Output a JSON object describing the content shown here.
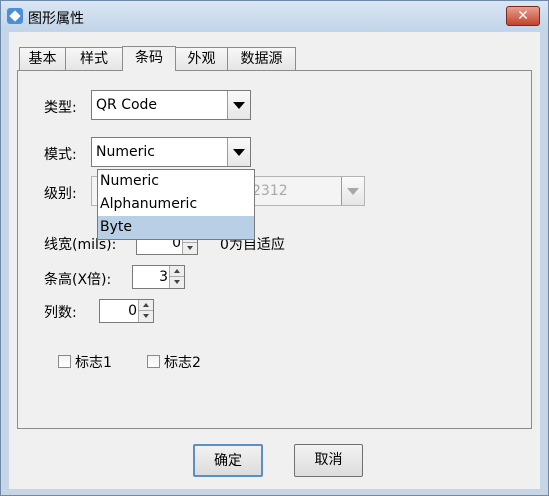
{
  "window": {
    "title": "图形属性",
    "close_label": "✕"
  },
  "tabs": [
    {
      "label": "基本"
    },
    {
      "label": "样式"
    },
    {
      "label": "条码",
      "active": true
    },
    {
      "label": "外观"
    },
    {
      "label": "数据源"
    }
  ],
  "form": {
    "type_label": "类型:",
    "type_value": "QR Code",
    "mode_label": "模式:",
    "mode_value": "Numeric",
    "level_label": "级别:",
    "level_value": "2312",
    "linewidth_label": "线宽(mils):",
    "linewidth_value": "0",
    "linewidth_hint": "0为自适应",
    "barheight_label": "条高(X倍):",
    "barheight_value": "3",
    "columns_label": "列数:",
    "columns_value": "0",
    "flag1_label": "标志1",
    "flag2_label": "标志2"
  },
  "mode_dropdown": {
    "options": [
      "Numeric",
      "Alphanumeric",
      "Byte"
    ],
    "highlighted": "Byte"
  },
  "buttons": {
    "ok": "确定",
    "cancel": "取消"
  }
}
